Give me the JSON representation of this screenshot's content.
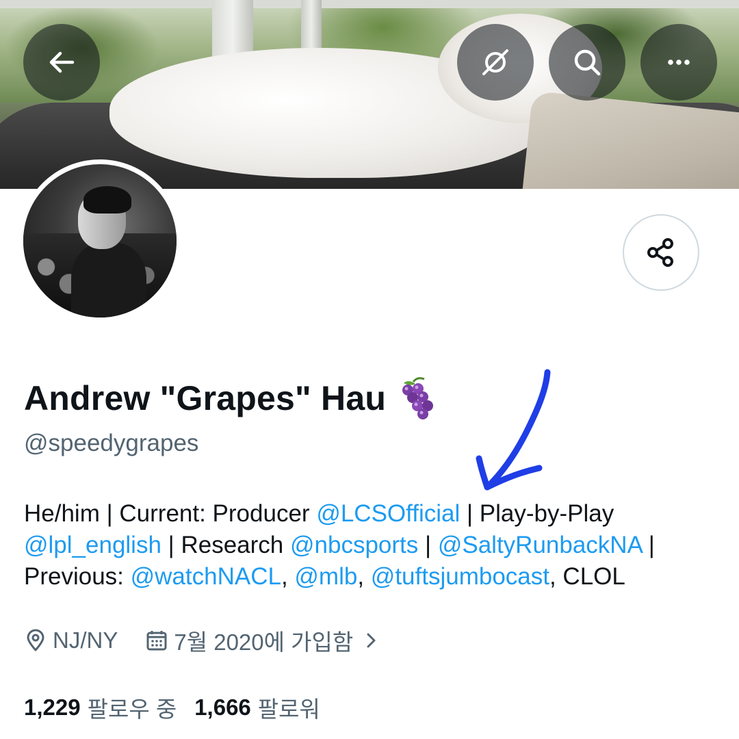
{
  "header": {
    "back_icon": "arrow-left-icon",
    "grok_icon": "grok-icon",
    "search_icon": "search-icon",
    "more_icon": "more-horizontal-icon",
    "banner_subject": "dog-on-couch"
  },
  "profile": {
    "display_name": "Andrew \"Grapes\" Hau",
    "name_emoji": "grapes-emoji",
    "handle": "@speedygrapes",
    "share_icon": "share-icon"
  },
  "bio": {
    "segments": [
      {
        "text": "He/him | Current: Producer ",
        "type": "text"
      },
      {
        "text": "@LCSOfficial",
        "type": "mention"
      },
      {
        "text": " | Play-by-Play ",
        "type": "text"
      },
      {
        "text": "@lpl_english",
        "type": "mention"
      },
      {
        "text": " | Research ",
        "type": "text"
      },
      {
        "text": "@nbcsports",
        "type": "mention"
      },
      {
        "text": " | ",
        "type": "text"
      },
      {
        "text": "@SaltyRunbackNA",
        "type": "mention"
      },
      {
        "text": " | Previous: ",
        "type": "text"
      },
      {
        "text": "@watchNACL",
        "type": "mention"
      },
      {
        "text": ", ",
        "type": "text"
      },
      {
        "text": "@mlb",
        "type": "mention"
      },
      {
        "text": ", ",
        "type": "text"
      },
      {
        "text": "@tuftsjumbocast",
        "type": "mention"
      },
      {
        "text": ", CLOL",
        "type": "text"
      }
    ]
  },
  "meta": {
    "location": "NJ/NY",
    "location_icon": "location-pin-icon",
    "joined": "7월 2020에 가입함",
    "joined_icon": "calendar-icon",
    "expand_icon": "chevron-right-icon"
  },
  "counts": {
    "following_count": "1,229",
    "following_label": "팔로우 중",
    "followers_count": "1,666",
    "followers_label": "팔로워"
  },
  "colors": {
    "link": "#1d9bf0",
    "secondary_text": "#536471",
    "primary_text": "#0f1419",
    "annotation": "#1f3ee6"
  }
}
